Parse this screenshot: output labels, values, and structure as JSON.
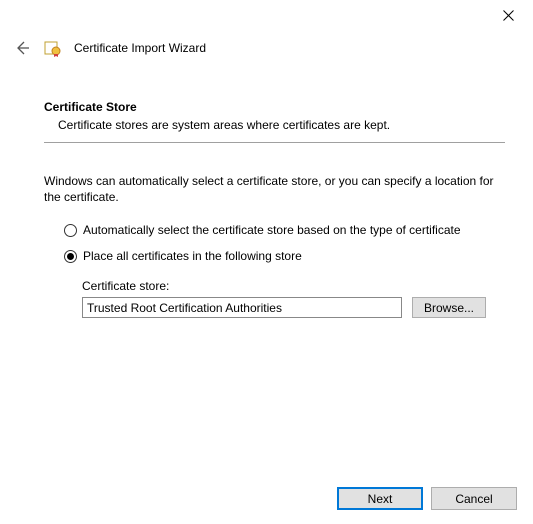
{
  "header": {
    "title": "Certificate Import Wizard"
  },
  "section": {
    "title": "Certificate Store",
    "description": "Certificate stores are system areas where certificates are kept."
  },
  "body": {
    "intro": "Windows can automatically select a certificate store, or you can specify a location for the certificate.",
    "options": {
      "auto": "Automatically select the certificate store based on the type of certificate",
      "place": "Place all certificates in the following store",
      "selected": "place"
    },
    "store": {
      "label": "Certificate store:",
      "value": "Trusted Root Certification Authorities",
      "browse": "Browse..."
    }
  },
  "footer": {
    "next": "Next",
    "cancel": "Cancel"
  }
}
